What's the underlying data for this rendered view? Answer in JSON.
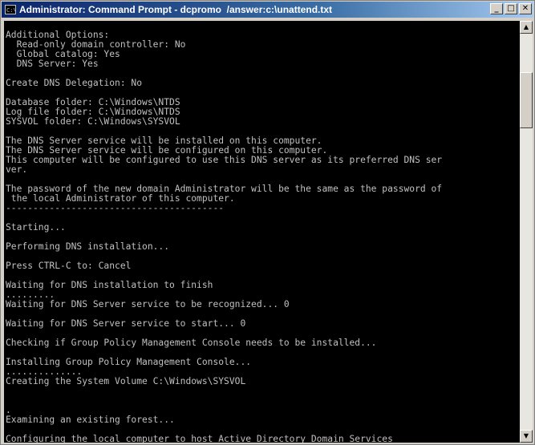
{
  "window": {
    "title": "Administrator: Command Prompt - dcpromo  /answer:c:\\unattend.txt",
    "icon_label": "C:\\",
    "buttons": {
      "minimize": "_",
      "maximize": "□",
      "close": "✕"
    }
  },
  "console": {
    "lines": [
      "",
      "Additional Options:",
      "  Read-only domain controller: No",
      "  Global catalog: Yes",
      "  DNS Server: Yes",
      "",
      "Create DNS Delegation: No",
      "",
      "Database folder: C:\\Windows\\NTDS",
      "Log file folder: C:\\Windows\\NTDS",
      "SYSVOL folder: C:\\Windows\\SYSVOL",
      "",
      "The DNS Server service will be installed on this computer.",
      "The DNS Server service will be configured on this computer.",
      "This computer will be configured to use this DNS server as its preferred DNS ser",
      "ver.",
      "",
      "The password of the new domain Administrator will be the same as the password of",
      " the local Administrator of this computer.",
      "----------------------------------------",
      "",
      "Starting...",
      "",
      "Performing DNS installation...",
      "",
      "Press CTRL-C to: Cancel",
      "",
      "Waiting for DNS installation to finish",
      ".........",
      "Waiting for DNS Server service to be recognized... 0",
      "",
      "Waiting for DNS Server service to start... 0",
      "",
      "Checking if Group Policy Management Console needs to be installed...",
      "",
      "Installing Group Policy Management Console...",
      "..............",
      "Creating the System Volume C:\\Windows\\SYSVOL",
      "",
      "",
      ".",
      "Examining an existing forest...",
      "",
      "Configuring the local computer to host Active Directory Domain Services",
      ".."
    ]
  },
  "scrollbar": {
    "up_arrow": "▲",
    "down_arrow": "▼"
  }
}
